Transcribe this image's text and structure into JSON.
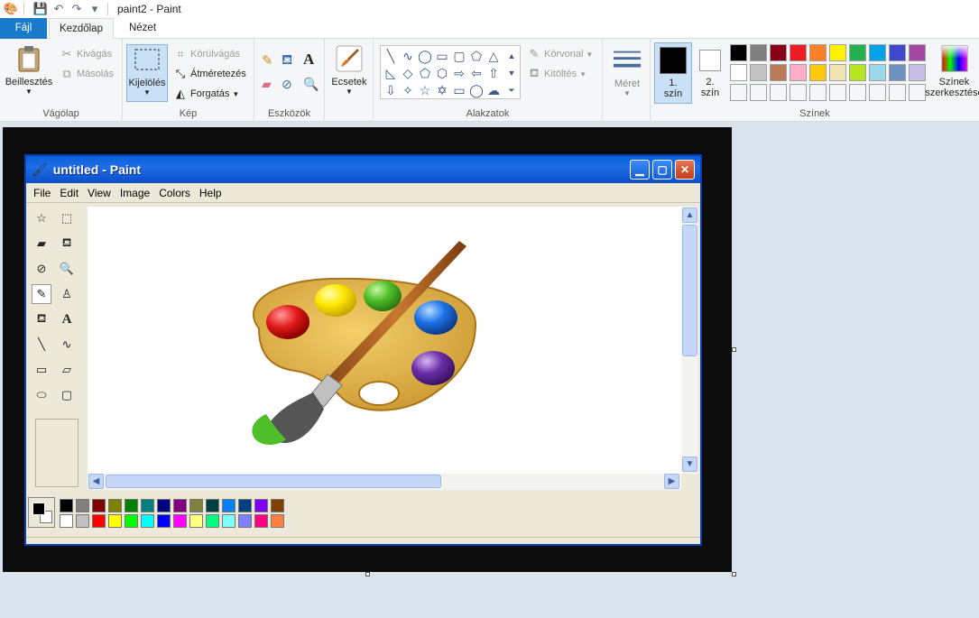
{
  "app": {
    "window_title": "paint2 - Paint"
  },
  "tabs": [
    {
      "label": "Fájl",
      "active": false
    },
    {
      "label": "Kezdőlap",
      "active": true
    },
    {
      "label": "Nézet",
      "active": false
    }
  ],
  "ribbon": {
    "clipboard": {
      "label": "Vágólap",
      "paste": "Beillesztés",
      "cut": "Kivágás",
      "copy": "Másolás"
    },
    "image": {
      "label": "Kép",
      "select": "Kijelölés",
      "crop": "Körülvágás",
      "resize": "Átméretezés",
      "rotate": "Forgatás"
    },
    "tools": {
      "label": "Eszközök",
      "text_glyph": "A"
    },
    "brushes": {
      "label": "Ecsetek"
    },
    "shapes": {
      "label": "Alakzatok",
      "outline": "Körvonal",
      "fill": "Kitöltés"
    },
    "size": {
      "label": "Méret"
    },
    "colors": {
      "label": "Színek",
      "color1_line1": "1.",
      "color1_line2": "szín",
      "color2_line1": "2.",
      "color2_line2": "szín",
      "edit_colors_line1": "Színek",
      "edit_colors_line2": "szerkesztése",
      "color1_value": "#000000",
      "color2_value": "#ffffff",
      "palette_row1": [
        "#000000",
        "#7f7f7f",
        "#880015",
        "#ed1c24",
        "#ff7f27",
        "#fff200",
        "#22b14c",
        "#00a2e8",
        "#3f48cc",
        "#a349a4"
      ],
      "palette_row2": [
        "#ffffff",
        "#c3c3c3",
        "#b97a57",
        "#ffaec9",
        "#ffc90e",
        "#efe4b0",
        "#b5e61d",
        "#99d9ea",
        "#7092be",
        "#c8bfe7"
      ],
      "palette_row3": [
        "#f5f6f7",
        "#f5f6f7",
        "#f5f6f7",
        "#f5f6f7",
        "#f5f6f7",
        "#f5f6f7",
        "#f5f6f7",
        "#f5f6f7",
        "#f5f6f7",
        "#f5f6f7"
      ]
    }
  },
  "xp_window": {
    "title": "untitled - Paint",
    "menus": [
      "File",
      "Edit",
      "View",
      "Image",
      "Colors",
      "Help"
    ],
    "text_tool_glyph": "A",
    "palette_row1": [
      "#000000",
      "#808080",
      "#800000",
      "#808000",
      "#008000",
      "#008080",
      "#000080",
      "#800080",
      "#808040",
      "#004040",
      "#0080ff",
      "#004080",
      "#8000ff",
      "#804000"
    ],
    "palette_row2": [
      "#ffffff",
      "#c0c0c0",
      "#ff0000",
      "#ffff00",
      "#00ff00",
      "#00ffff",
      "#0000ff",
      "#ff00ff",
      "#ffff80",
      "#00ff80",
      "#80ffff",
      "#8080ff",
      "#ff0080",
      "#ff8040"
    ]
  }
}
